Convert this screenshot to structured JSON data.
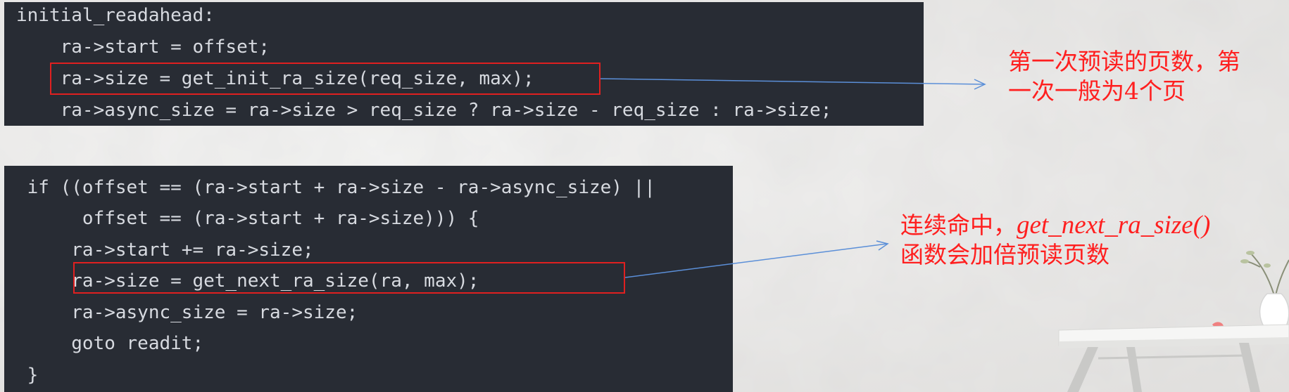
{
  "code_block_1": {
    "lines": [
      "initial_readahead:",
      "    ra->start = offset;",
      "    ra->size = get_init_ra_size(req_size, max);",
      "    ra->async_size = ra->size > req_size ? ra->size - req_size : ra->size;"
    ]
  },
  "code_block_2": {
    "lines": [
      " if ((offset == (ra->start + ra->size - ra->async_size) ||",
      "      offset == (ra->start + ra->size))) {",
      "     ra->start += ra->size;",
      "     ra->size = get_next_ra_size(ra, max);",
      "     ra->async_size = ra->size;",
      "     goto readit;",
      " }"
    ]
  },
  "annotation_1": {
    "line1": "第一次预读的页数，第",
    "line2": "一次一般为4个页"
  },
  "annotation_2": {
    "line1_prefix": "连续命中，",
    "line1_fn": "get_next_ra_size()",
    "line2": "函数会加倍预读页数"
  },
  "colors": {
    "code_background": "#282c34",
    "code_text": "#d7dae0",
    "highlight_box": "#e02020",
    "annotation_text": "#ff1f1f",
    "arrow": "#5b8fd8"
  }
}
